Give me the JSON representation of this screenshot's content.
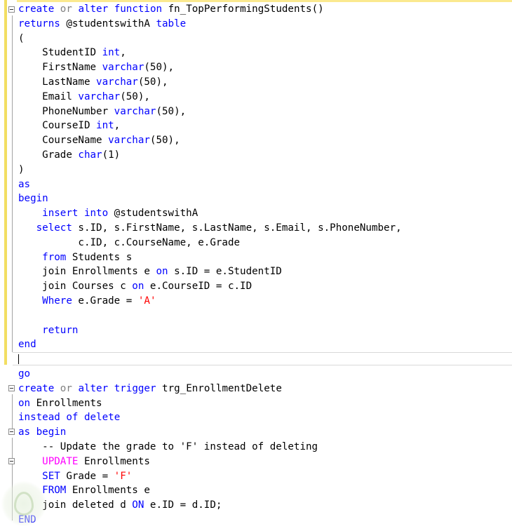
{
  "editor": {
    "lines": [
      [
        {
          "t": "create",
          "c": "k"
        },
        {
          "t": " "
        },
        {
          "t": "or",
          "c": "g"
        },
        {
          "t": " "
        },
        {
          "t": "alter",
          "c": "k"
        },
        {
          "t": " "
        },
        {
          "t": "function",
          "c": "k"
        },
        {
          "t": " fn_TopPerformingStudents()"
        }
      ],
      [
        {
          "t": "returns",
          "c": "k"
        },
        {
          "t": " @studentswithA "
        },
        {
          "t": "table",
          "c": "k"
        }
      ],
      [
        {
          "t": "("
        }
      ],
      [
        {
          "t": "    StudentID "
        },
        {
          "t": "int",
          "c": "k"
        },
        {
          "t": ","
        }
      ],
      [
        {
          "t": "    FirstName "
        },
        {
          "t": "varchar",
          "c": "k"
        },
        {
          "t": "(50),"
        }
      ],
      [
        {
          "t": "    LastName "
        },
        {
          "t": "varchar",
          "c": "k"
        },
        {
          "t": "(50),"
        }
      ],
      [
        {
          "t": "    Email "
        },
        {
          "t": "varchar",
          "c": "k"
        },
        {
          "t": "(50),"
        }
      ],
      [
        {
          "t": "    PhoneNumber "
        },
        {
          "t": "varchar",
          "c": "k"
        },
        {
          "t": "(50),"
        }
      ],
      [
        {
          "t": "    CourseID "
        },
        {
          "t": "int",
          "c": "k"
        },
        {
          "t": ","
        }
      ],
      [
        {
          "t": "    CourseName "
        },
        {
          "t": "varchar",
          "c": "k"
        },
        {
          "t": "(50),"
        }
      ],
      [
        {
          "t": "    Grade "
        },
        {
          "t": "char",
          "c": "k"
        },
        {
          "t": "(1)"
        }
      ],
      [
        {
          "t": ")"
        }
      ],
      [
        {
          "t": "as",
          "c": "k"
        }
      ],
      [
        {
          "t": "begin",
          "c": "k"
        }
      ],
      [
        {
          "t": "    "
        },
        {
          "t": "insert",
          "c": "k"
        },
        {
          "t": " "
        },
        {
          "t": "into",
          "c": "k"
        },
        {
          "t": " @studentswithA"
        }
      ],
      [
        {
          "t": "   "
        },
        {
          "t": "select",
          "c": "k"
        },
        {
          "t": " s.ID, s.FirstName, s.LastName, s.Email, s.PhoneNumber,"
        }
      ],
      [
        {
          "t": "          c.ID, c.CourseName, e.Grade"
        }
      ],
      [
        {
          "t": "    "
        },
        {
          "t": "from",
          "c": "k"
        },
        {
          "t": " Students s"
        }
      ],
      [
        {
          "t": "    join Enrollments e "
        },
        {
          "t": "on",
          "c": "k"
        },
        {
          "t": " s.ID = e.StudentID"
        }
      ],
      [
        {
          "t": "    join Courses c "
        },
        {
          "t": "on",
          "c": "k"
        },
        {
          "t": " e.CourseID = c.ID"
        }
      ],
      [
        {
          "t": "    "
        },
        {
          "t": "Where",
          "c": "k"
        },
        {
          "t": " e.Grade = "
        },
        {
          "t": "'A'",
          "c": "s"
        }
      ],
      [
        {
          "t": ""
        }
      ],
      [
        {
          "t": "    "
        },
        {
          "t": "return",
          "c": "k"
        }
      ],
      [
        {
          "t": "end",
          "c": "k"
        }
      ],
      [
        {
          "t": ""
        }
      ],
      [
        {
          "t": "go",
          "c": "k"
        }
      ],
      [
        {
          "t": "create",
          "c": "k"
        },
        {
          "t": " "
        },
        {
          "t": "or",
          "c": "g"
        },
        {
          "t": " "
        },
        {
          "t": "alter",
          "c": "k"
        },
        {
          "t": " "
        },
        {
          "t": "trigger",
          "c": "k"
        },
        {
          "t": " trg_EnrollmentDelete"
        }
      ],
      [
        {
          "t": "on",
          "c": "k"
        },
        {
          "t": " Enrollments"
        }
      ],
      [
        {
          "t": "instead",
          "c": "k"
        },
        {
          "t": " "
        },
        {
          "t": "of",
          "c": "k"
        },
        {
          "t": " "
        },
        {
          "t": "delete",
          "c": "k"
        }
      ],
      [
        {
          "t": "as",
          "c": "k"
        },
        {
          "t": " "
        },
        {
          "t": "begin",
          "c": "k"
        }
      ],
      [
        {
          "t": "    -- Update the grade to 'F' instead of deleting"
        }
      ],
      [
        {
          "t": "    "
        },
        {
          "t": "UPDATE",
          "c": "f"
        },
        {
          "t": " Enrollments"
        }
      ],
      [
        {
          "t": "    "
        },
        {
          "t": "SET",
          "c": "k"
        },
        {
          "t": " Grade = "
        },
        {
          "t": "'F'",
          "c": "s"
        }
      ],
      [
        {
          "t": "    "
        },
        {
          "t": "FROM",
          "c": "k"
        },
        {
          "t": " Enrollments e"
        }
      ],
      [
        {
          "t": "    join deleted d "
        },
        {
          "t": "ON",
          "c": "k"
        },
        {
          "t": " e.ID = d.ID;"
        }
      ],
      [
        {
          "t": "END",
          "c": "k"
        }
      ]
    ]
  },
  "colors": {
    "keyword": "#0000ff",
    "function": "#ff00ff",
    "string": "#ff0000",
    "operator": "#808080",
    "text": "#000000",
    "changed_margin": "#f2de62"
  }
}
